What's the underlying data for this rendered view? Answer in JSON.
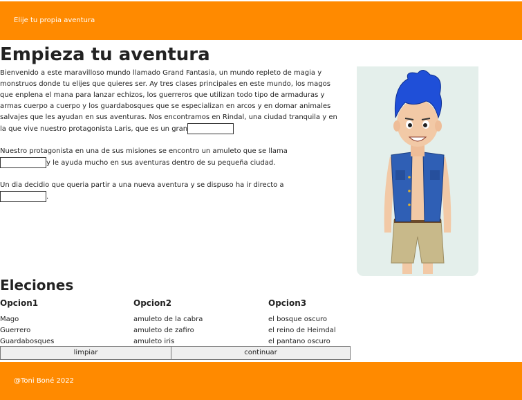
{
  "header": {
    "title": "Elije tu propia aventura"
  },
  "main": {
    "title": "Empieza tu aventura",
    "paragraph1": "Bienvenido a este maravilloso mundo llamado Grand Fantasia, un mundo repleto de magia y monstruos donde tu elijes que quieres ser. Ay tres clases principales en este mundo, los magos que enplena el mana para lanzar echizos, los guerreros que utilizan todo tipo de armaduras y armas cuerpo a cuerpo y los guardabosques que se especializan en arcos y en domar animales salvajes que les ayudan en sus aventuras. Nos encontramos en Rindal, una ciudad tranquila y en la que vive nuestro protagonista Laris, que es un gran",
    "paragraph2_a": "Nuestro protagonista en una de sus misiones se encontro un amuleto que se llama",
    "paragraph2_b": "y le ayuda mucho en sus aventuras dentro de su pequeña ciudad.",
    "paragraph3_a": "Un dia decidio que queria partir a una nueva aventura y se dispuso ha ir directo a",
    "paragraph3_b": "."
  },
  "options_section": {
    "title": "Eleciones",
    "columns": [
      {
        "header": "Opcion1",
        "items": [
          "Mago",
          "Guerrero",
          "Guardabosques"
        ]
      },
      {
        "header": "Opcion2",
        "items": [
          "amuleto de la cabra",
          "amuleto de zafiro",
          "amuleto iris"
        ]
      },
      {
        "header": "Opcion3",
        "items": [
          "el bosque oscuro",
          "el reino de Heimdal",
          "el pantano oscuro"
        ]
      }
    ]
  },
  "buttons": {
    "clear": "limpiar",
    "continue": "continuar"
  },
  "footer": {
    "text": "@Toni Boné 2022"
  },
  "colors": {
    "brand": "#ff8a00",
    "character_bg": "#e4efeb",
    "hair": "#1f4fd8",
    "vest": "#2f5fb5",
    "shorts": "#c8b98a"
  },
  "icons": {
    "character": "cartoon-boy-character-illustration"
  }
}
